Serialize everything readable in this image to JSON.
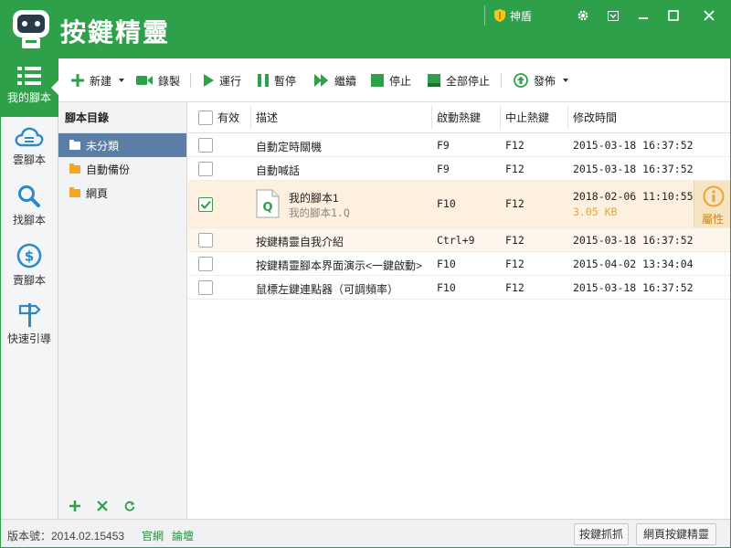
{
  "app": {
    "title": "按鍵精靈"
  },
  "titlebar": {
    "shield_label": "神盾",
    "icons": [
      "shield-icon",
      "gear-icon",
      "skin-icon",
      "minimize-icon",
      "maximize-icon",
      "close-icon"
    ]
  },
  "nav": {
    "items": [
      {
        "label": "我的腳本",
        "icon": "list-icon"
      },
      {
        "label": "雲腳本",
        "icon": "cloud-icon"
      },
      {
        "label": "找腳本",
        "icon": "search-icon"
      },
      {
        "label": "賣腳本",
        "icon": "dollar-icon"
      },
      {
        "label": "快速引導",
        "icon": "signpost-icon"
      }
    ]
  },
  "toolbar": {
    "new_label": "新建",
    "record_label": "錄製",
    "run_label": "運行",
    "pause_label": "暫停",
    "continue_label": "繼續",
    "stop_label": "停止",
    "stop_all_label": "全部停止",
    "publish_label": "發佈"
  },
  "catalog": {
    "title": "腳本目錄",
    "folders": [
      "未分類",
      "自動備份",
      "網頁"
    ],
    "selected": "未分類"
  },
  "table": {
    "columns": [
      "有效",
      "描述",
      "啟動熱鍵",
      "中止熱鍵",
      "修改時間"
    ],
    "rows": [
      {
        "checked": false,
        "desc": "自動定時關機",
        "start": "F9",
        "stop": "F12",
        "time": "2015-03-18 16:37:52"
      },
      {
        "checked": false,
        "desc": "自動喊話",
        "start": "F9",
        "stop": "F12",
        "time": "2015-03-18 16:37:52"
      },
      {
        "checked": true,
        "desc": "我的腳本1",
        "file": "我的腳本1.Q",
        "start": "F10",
        "stop": "F12",
        "time": "2018-02-06 11:10:55",
        "size": "3.05 KB",
        "prop_label": "屬性"
      },
      {
        "checked": false,
        "desc": "按鍵精靈自我介紹",
        "start": "Ctrl+9",
        "stop": "F12",
        "time": "2015-03-18 16:37:52"
      },
      {
        "checked": false,
        "desc": "按鍵精靈腳本界面演示<一鍵啟動>",
        "start": "F10",
        "stop": "F12",
        "time": "2015-04-02 13:34:04"
      },
      {
        "checked": false,
        "desc": "鼠標左鍵連點器（可調頻率）",
        "start": "F10",
        "stop": "F12",
        "time": "2015-03-18 16:37:52"
      }
    ]
  },
  "status": {
    "version": "版本號：2014.02.15453",
    "link_official": "官網",
    "link_forum": "論壇",
    "btn_capture": "按鍵抓抓",
    "btn_web": "網頁按鍵精靈"
  },
  "colors": {
    "brand": "#2ea04a",
    "selected_folder": "#5a7ea5",
    "highlight_row": "#fdf0de",
    "accent_orange": "#e8a33a"
  }
}
